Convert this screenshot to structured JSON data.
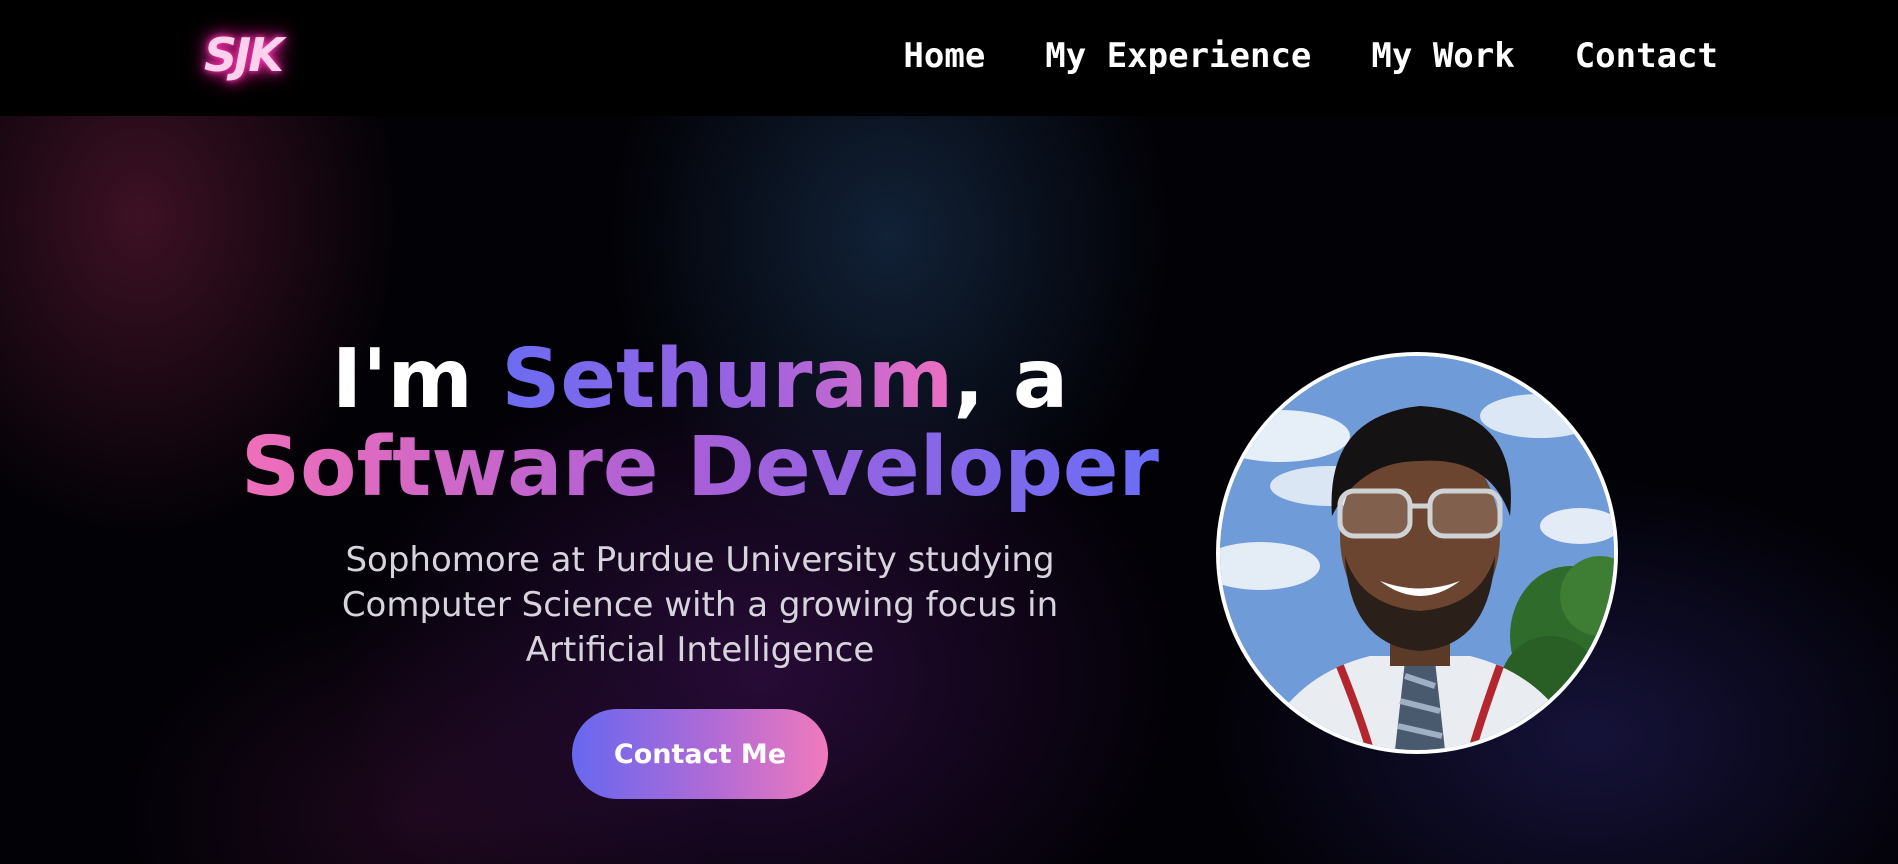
{
  "header": {
    "logo": "SJK",
    "nav": [
      "Home",
      "My Experience",
      "My Work",
      "Contact"
    ]
  },
  "hero": {
    "greeting_prefix": "I'm ",
    "name": "Sethuram",
    "greeting_suffix": ", a",
    "role": "Software Developer",
    "subtitle": "Sophomore at Purdue University studying Computer Science with a growing focus in Artificial Intelligence",
    "cta_label": "Contact Me"
  },
  "colors": {
    "accent_blue": "#6b6cf2",
    "accent_purple": "#a75fd8",
    "accent_pink": "#f06eb9",
    "logo_glow": "#ff3fb5",
    "background": "#000000"
  }
}
